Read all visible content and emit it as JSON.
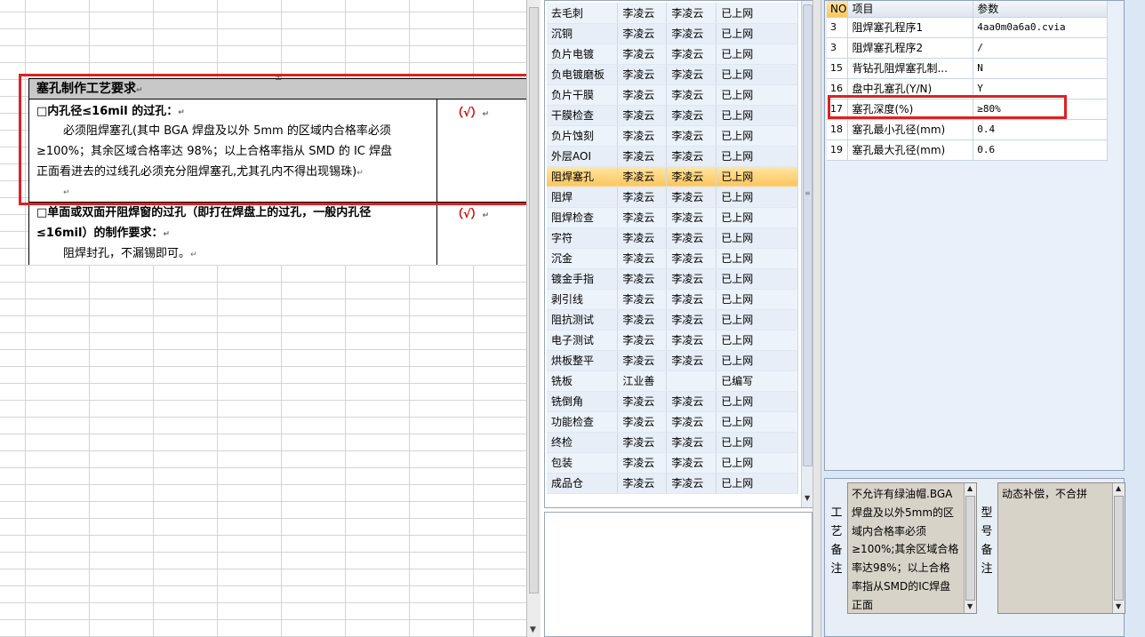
{
  "document": {
    "header": "塞孔制作工艺要求",
    "section1": {
      "title": "□内孔径≤16mil 的过孔：",
      "lines": [
        "必须阻焊塞孔(其中 BGA 焊盘及以外 5mm 的区域内合格率必须",
        "≥100%；其余区域合格率达 98%；以上合格率指从 SMD 的 IC 焊盘",
        "正面看进去的过线孔必须充分阻焊塞孔,尤其孔内不得出现锡珠)"
      ],
      "check": "（√）"
    },
    "section2": {
      "title_lines": [
        "□单面或双面开阻焊窗的过孔（即打在焊盘上的过孔，一般内孔径",
        "≤16mil）的制作要求："
      ],
      "line": "阻焊封孔，不漏锡即可。",
      "check": "（√）"
    },
    "para_mark": "↵",
    "cursor_mark": "±"
  },
  "process_list": {
    "rows": [
      [
        "去毛刺",
        "李凌云",
        "李凌云",
        "已上网"
      ],
      [
        "沉铜",
        "李凌云",
        "李凌云",
        "已上网"
      ],
      [
        "负片电镀",
        "李凌云",
        "李凌云",
        "已上网"
      ],
      [
        "负电镀磨板",
        "李凌云",
        "李凌云",
        "已上网"
      ],
      [
        "负片干膜",
        "李凌云",
        "李凌云",
        "已上网"
      ],
      [
        "干膜检查",
        "李凌云",
        "李凌云",
        "已上网"
      ],
      [
        "负片蚀刻",
        "李凌云",
        "李凌云",
        "已上网"
      ],
      [
        "外层AOI",
        "李凌云",
        "李凌云",
        "已上网"
      ],
      [
        "阻焊塞孔",
        "李凌云",
        "李凌云",
        "已上网"
      ],
      [
        "阻焊",
        "李凌云",
        "李凌云",
        "已上网"
      ],
      [
        "阻焊检查",
        "李凌云",
        "李凌云",
        "已上网"
      ],
      [
        "字符",
        "李凌云",
        "李凌云",
        "已上网"
      ],
      [
        "沉金",
        "李凌云",
        "李凌云",
        "已上网"
      ],
      [
        "镀金手指",
        "李凌云",
        "李凌云",
        "已上网"
      ],
      [
        "剥引线",
        "李凌云",
        "李凌云",
        "已上网"
      ],
      [
        "阻抗测试",
        "李凌云",
        "李凌云",
        "已上网"
      ],
      [
        "电子测试",
        "李凌云",
        "李凌云",
        "已上网"
      ],
      [
        "烘板整平",
        "李凌云",
        "李凌云",
        "已上网"
      ],
      [
        "铣板",
        "江业善",
        "",
        "已编写"
      ],
      [
        "铣倒角",
        "李凌云",
        "李凌云",
        "已上网"
      ],
      [
        "功能检查",
        "李凌云",
        "李凌云",
        "已上网"
      ],
      [
        "终检",
        "李凌云",
        "李凌云",
        "已上网"
      ],
      [
        "包装",
        "李凌云",
        "李凌云",
        "已上网"
      ],
      [
        "成品仓",
        "李凌云",
        "李凌云",
        "已上网"
      ]
    ],
    "selected_index": 8
  },
  "params": {
    "columns": [
      "NO",
      "项目",
      "参数"
    ],
    "rows": [
      [
        "3",
        "阻焊塞孔程序1",
        "4aa0m0a6a0.cvia"
      ],
      [
        "3",
        "阻焊塞孔程序2",
        "/"
      ],
      [
        "15",
        "背钻孔阻焊塞孔制...",
        "N"
      ],
      [
        "16",
        "盘中孔塞孔(Y/N)",
        "Y"
      ],
      [
        "17",
        "塞孔深度(%)",
        "≥80%"
      ],
      [
        "18",
        "塞孔最小孔径(mm)",
        "0.4"
      ],
      [
        "19",
        "塞孔最大孔径(mm)",
        "0.6"
      ]
    ]
  },
  "notes": {
    "process_label": "工艺备注",
    "process_text": "不允许有绿油帽.BGA焊盘及以外5mm的区域内合格率必须≥100%;其余区域合格率达98%；以上合格率指从SMD的IC焊盘正面",
    "model_label": "型号备注",
    "model_text": "动态补偿，不合拼"
  },
  "icons": {
    "scroll_up": "▲",
    "scroll_down": "▼",
    "grip": "≡"
  }
}
